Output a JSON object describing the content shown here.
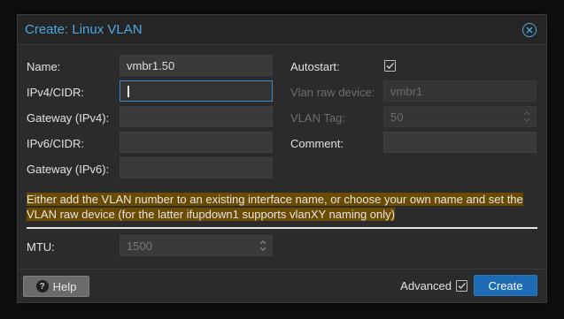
{
  "dialog": {
    "title": "Create: Linux VLAN",
    "close_icon": "close-icon"
  },
  "form": {
    "name": {
      "label": "Name:",
      "value": "vmbr1.50"
    },
    "ipv4": {
      "label": "IPv4/CIDR:",
      "value": ""
    },
    "gateway_ipv4": {
      "label": "Gateway (IPv4):",
      "value": ""
    },
    "ipv6": {
      "label": "IPv6/CIDR:",
      "value": ""
    },
    "gateway_ipv6": {
      "label": "Gateway (IPv6):",
      "value": ""
    },
    "autostart": {
      "label": "Autostart:",
      "checked": true
    },
    "vlan_raw_device": {
      "label": "Vlan raw device:",
      "value": "vmbr1"
    },
    "vlan_tag": {
      "label": "VLAN Tag:",
      "value": "50"
    },
    "comment": {
      "label": "Comment:",
      "value": ""
    },
    "mtu": {
      "label": "MTU:",
      "placeholder": "1500"
    }
  },
  "info_text": {
    "line1": "Either add the VLAN number to an existing interface name, or choose your own name and set the",
    "line2": "VLAN raw device (for the latter ifupdown1 supports vlanXY naming only)"
  },
  "footer": {
    "help_label": "Help",
    "advanced_label": "Advanced",
    "advanced_checked": true,
    "create_label": "Create"
  },
  "colors": {
    "accent": "#4ea7e3",
    "primary_button": "#1d6bb4",
    "warning_highlight": "#6b4a02"
  }
}
